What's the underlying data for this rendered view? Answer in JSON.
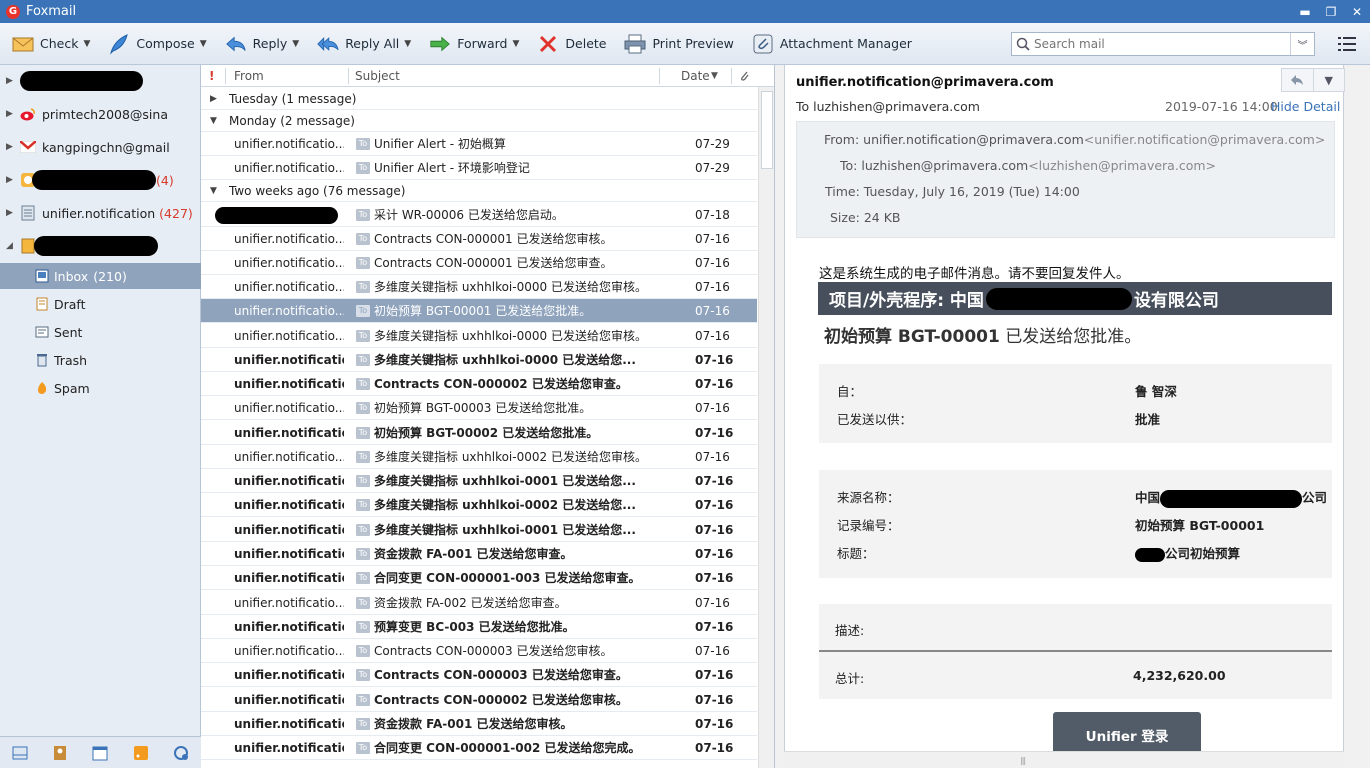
{
  "app": {
    "title": "Foxmail"
  },
  "toolbar": {
    "check": "Check",
    "compose": "Compose",
    "reply": "Reply",
    "reply_all": "Reply All",
    "forward": "Forward",
    "delete": "Delete",
    "print_preview": "Print Preview",
    "attachment_manager": "Attachment Manager",
    "search_placeholder": "Search mail"
  },
  "accounts": [
    {
      "name": "",
      "redacted": true
    },
    {
      "name": "primtech2008@sina"
    },
    {
      "name": "kangpingchn@gmail"
    },
    {
      "name": "",
      "redacted": true,
      "count": "(4)"
    },
    {
      "name": "unifier.notification",
      "count": "(427)"
    },
    {
      "name": "",
      "redacted": true
    }
  ],
  "folders": [
    {
      "name": "Inbox",
      "count": "(210)"
    },
    {
      "name": "Draft"
    },
    {
      "name": "Sent"
    },
    {
      "name": "Trash"
    },
    {
      "name": "Spam"
    }
  ],
  "list": {
    "headers": {
      "flag": "!",
      "from": "From",
      "subject": "Subject",
      "date": "Date"
    },
    "groups": [
      {
        "label": "Tuesday (1 message)"
      },
      {
        "label": "Monday (2 message)"
      },
      {
        "label": "Two weeks ago (76 message)"
      }
    ],
    "to_badge": "To",
    "rows": [
      {
        "from": "unifier.notificatio...",
        "subject": "Unifier Alert - 初始概算",
        "date": "07-29"
      },
      {
        "from": "unifier.notificatio...",
        "subject": "Unifier Alert - 环境影响登记",
        "date": "07-29"
      },
      {
        "from": "",
        "subject": "采计 WR-00006 已发送给您启动。",
        "date": "07-18"
      },
      {
        "from": "unifier.notificatio...",
        "subject": "Contracts CON-000001 已发送给您审核。",
        "date": "07-16"
      },
      {
        "from": "unifier.notificatio...",
        "subject": "Contracts CON-000001 已发送给您审查。",
        "date": "07-16"
      },
      {
        "from": "unifier.notificatio...",
        "subject": "多维度关键指标 uxhhlkoi-0000 已发送给您审核。",
        "date": "07-16"
      },
      {
        "from": "unifier.notificatio...",
        "subject": "初始预算 BGT-00001 已发送给您批准。",
        "date": "07-16"
      },
      {
        "from": "unifier.notificatio...",
        "subject": "多维度关键指标 uxhhlkoi-0000 已发送给您审核。",
        "date": "07-16"
      },
      {
        "from": "unifier.notificatio...",
        "subject": "多维度关键指标 uxhhlkoi-0000 已发送给您...",
        "date": "07-16"
      },
      {
        "from": "unifier.notificatio...",
        "subject": "Contracts CON-000002 已发送给您审查。",
        "date": "07-16"
      },
      {
        "from": "unifier.notificatio...",
        "subject": "初始预算 BGT-00003 已发送给您批准。",
        "date": "07-16"
      },
      {
        "from": "unifier.notificatio...",
        "subject": "初始预算 BGT-00002 已发送给您批准。",
        "date": "07-16"
      },
      {
        "from": "unifier.notificatio...",
        "subject": "多维度关键指标 uxhhlkoi-0002 已发送给您审核。",
        "date": "07-16"
      },
      {
        "from": "unifier.notificatio...",
        "subject": "多维度关键指标 uxhhlkoi-0001 已发送给您...",
        "date": "07-16"
      },
      {
        "from": "unifier.notificatio...",
        "subject": "多维度关键指标 uxhhlkoi-0002 已发送给您...",
        "date": "07-16"
      },
      {
        "from": "unifier.notificatio...",
        "subject": "多维度关键指标 uxhhlkoi-0001 已发送给您...",
        "date": "07-16"
      },
      {
        "from": "unifier.notificatio...",
        "subject": "资金拨款 FA-001 已发送给您审查。",
        "date": "07-16"
      },
      {
        "from": "unifier.notificatio...",
        "subject": "合同变更 CON-000001-003 已发送给您审查。",
        "date": "07-16"
      },
      {
        "from": "unifier.notificatio...",
        "subject": "资金拨款 FA-002 已发送给您审查。",
        "date": "07-16"
      },
      {
        "from": "unifier.notificatio...",
        "subject": "预算变更 BC-003 已发送给您批准。",
        "date": "07-16"
      },
      {
        "from": "unifier.notificatio...",
        "subject": "Contracts CON-000003 已发送给您审核。",
        "date": "07-16"
      },
      {
        "from": "unifier.notificatio...",
        "subject": "Contracts CON-000003 已发送给您审查。",
        "date": "07-16"
      },
      {
        "from": "unifier.notificatio...",
        "subject": "Contracts CON-000002 已发送给您审核。",
        "date": "07-16"
      },
      {
        "from": "unifier.notificatio...",
        "subject": "资金拨款 FA-001 已发送给您审核。",
        "date": "07-16"
      },
      {
        "from": "unifier.notificatio...",
        "subject": "合同变更 CON-000001-002 已发送给您完成。",
        "date": "07-16"
      }
    ]
  },
  "reading": {
    "from": "unifier.notification@primavera.com",
    "to": "To luzhishen@primavera.com",
    "date": "2019-07-16 14:00",
    "hide_detail": "Hide Detail",
    "detail": {
      "from_label": "From:",
      "from_value": "unifier.notification@primavera.com",
      "from_addr": "<unifier.notification@primavera.com>",
      "to_label": "To:",
      "to_value": "luzhishen@primavera.com",
      "to_addr": "<luzhishen@primavera.com>",
      "time": "Time: Tuesday, July 16, 2019 (Tue) 14:00",
      "size": "Size: 24 KB"
    },
    "body": {
      "system_msg": "这是系统生成的电子邮件消息。请不要回复发件人。",
      "band_prefix": "项目/外壳程序: 中国",
      "band_suffix": "设有限公司",
      "title_bold": "初始预算 BGT-00001",
      "title_rest": "已发送给您批准。",
      "from_label": "自：",
      "from_value": "鲁 智深",
      "sent_label": "已发送以供：",
      "sent_value": "批准",
      "source_label": "来源名称：",
      "source_prefix": "中国",
      "source_suffix": "公司",
      "record_label": "记录编号：",
      "record_value": "初始预算 BGT-00001",
      "title_label": "标题：",
      "title_value_suffix": "公司初始预算",
      "desc_label": "描述:",
      "total_label": "总计:",
      "total_value": "4,232,620.00",
      "login_button": "Unifier 登录"
    }
  }
}
